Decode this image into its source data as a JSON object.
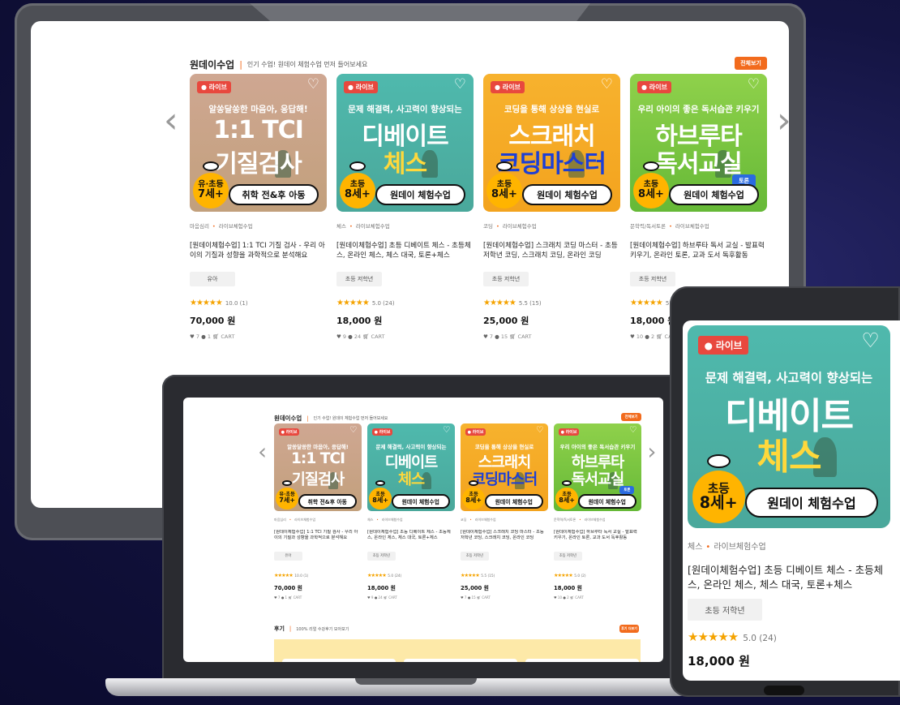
{
  "section": {
    "title": "원데이수업",
    "subtitle": "인기 수업! 원데이 체험수업 먼저 들어보세요",
    "view_all": "전체보기"
  },
  "review": {
    "title": "후기",
    "subtitle": "100% 리얼 수강후기 모아보기",
    "button": "후기 더보기"
  },
  "live_label": "● 라이브",
  "cards": [
    {
      "theme": "pink",
      "thumb_top": "알쏭달쏭한 마음아, 응답해!",
      "thumb_line1": "1:1 TCI",
      "thumb_line2": "기질검사",
      "age_top": "유·초등",
      "age_bottom": "7세+",
      "pill": "취학 전&후 아동",
      "category": "마음심리",
      "type": "라이브체험수업",
      "title": "[원데이체험수업] 1:1 TCI 기질 검사 - 우리 아이의 기질과 성향을 과학적으로 분석해요",
      "tag": "유아",
      "rating": "10.0 (1)",
      "price": "70,000 원",
      "likes": "7",
      "comments": "1",
      "cart": "CART"
    },
    {
      "theme": "teal",
      "thumb_top": "문제 해결력, 사고력이 향상되는",
      "thumb_line1": "디베이트",
      "thumb_line2": "체스",
      "age_top": "초등",
      "age_bottom": "8세+",
      "pill": "원데이 체험수업",
      "category": "체스",
      "type": "라이브체험수업",
      "title": "[원데이체험수업] 초등 디베이트 체스 - 초등체스, 온라인 체스, 체스 대국, 토론+체스",
      "tag": "초등 저학년",
      "rating": "5.0 (24)",
      "price": "18,000 원",
      "likes": "9",
      "comments": "24",
      "cart": "CART"
    },
    {
      "theme": "orange",
      "thumb_top": "코딩을 통해 상상을 현실로",
      "thumb_line1": "스크래치",
      "thumb_line2": "코딩마스터",
      "age_top": "초등",
      "age_bottom": "8세+",
      "pill": "원데이 체험수업",
      "category": "코딩",
      "type": "라이브체험수업",
      "title": "[원데이체험수업] 스크래치 코딩 마스터 - 초등 저학년 코딩, 스크래치 코딩, 온라인 코딩",
      "tag": "초등 저학년",
      "rating": "5.5 (15)",
      "price": "25,000 원",
      "likes": "7",
      "comments": "15",
      "cart": "CART"
    },
    {
      "theme": "green",
      "thumb_top": "우리 아이의 좋은 독서습관 키우기",
      "thumb_line1": "하브루타",
      "thumb_line2": "독서교실",
      "toron": "토론",
      "age_top": "초등",
      "age_bottom": "8세+",
      "pill": "원데이 체험수업",
      "category": "문학력/독서토론",
      "type": "라이브체험수업",
      "title": "[원데이체험수업] 하브루타 독서 교실 - 발표력 키우기, 온라인 토론, 교과 도서 독후활동",
      "tag": "초등 저학년",
      "rating": "5.0 (2)",
      "price": "18,000 원",
      "likes": "10",
      "comments": "2",
      "cart": "CART"
    }
  ],
  "stars": "★★★★★",
  "icons": {
    "prev": "chevron-left-icon",
    "next": "chevron-right-icon",
    "heart": "heart-outline-icon",
    "like": "heart-icon",
    "comment": "comment-icon",
    "cart": "cart-icon"
  },
  "colors": {
    "accent": "#f26b1d",
    "live": "#e8483e",
    "star": "#f5a300",
    "background": "#141442"
  }
}
